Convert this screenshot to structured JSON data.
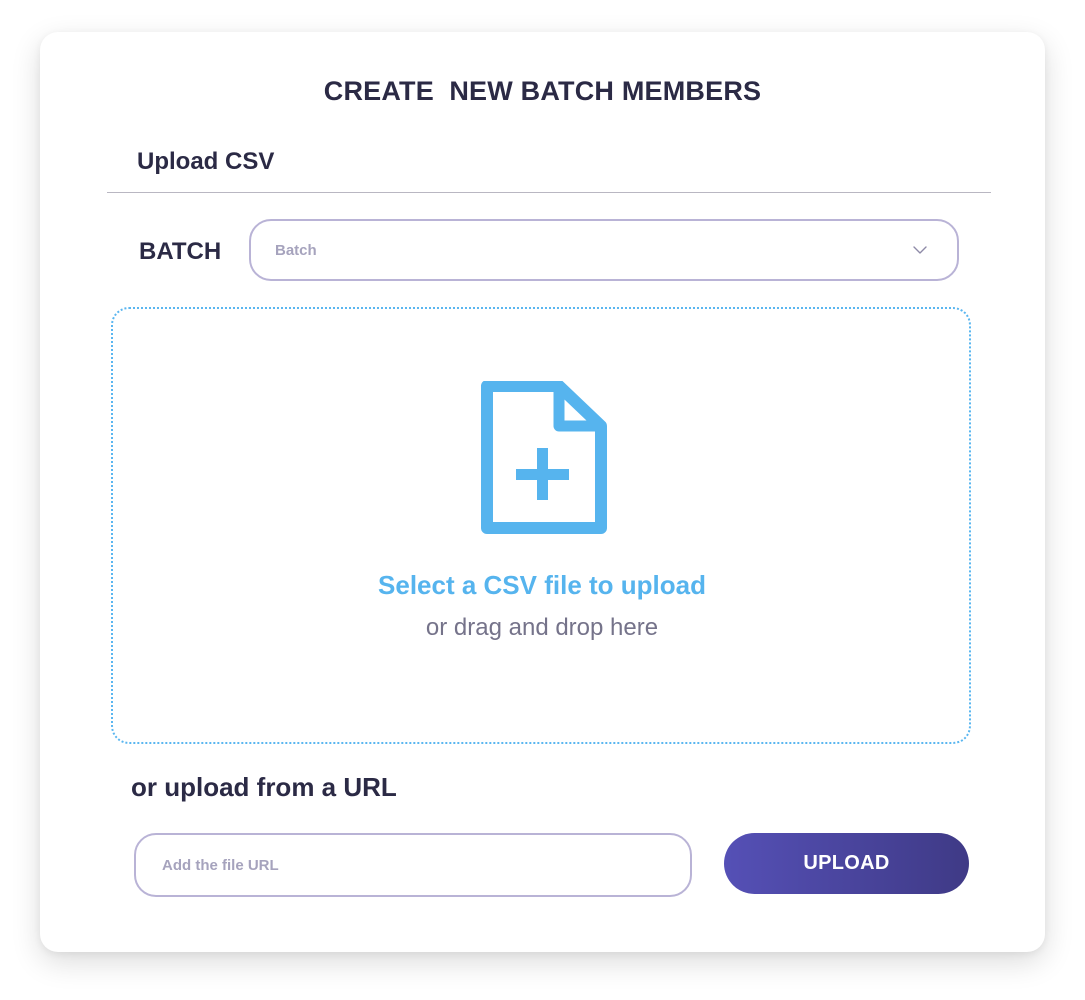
{
  "dialog": {
    "title": "CREATE  NEW BATCH MEMBERS",
    "subtitle": "Upload CSV"
  },
  "batch": {
    "label": "BATCH",
    "selected_value": "Batch"
  },
  "dropzone": {
    "primary_text": "Select a CSV file to upload",
    "secondary_text": "or drag and drop here",
    "icon": "file-plus-icon"
  },
  "url_upload": {
    "heading": "or upload from a URL",
    "placeholder": "Add the file URL",
    "button_label": "UPLOAD"
  },
  "colors": {
    "accent_blue": "#56b4ee",
    "text_dark": "#2b2a45",
    "button_gradient_start": "#5550b6",
    "button_gradient_end": "#3f3a86",
    "input_border": "#b9b3d6"
  }
}
